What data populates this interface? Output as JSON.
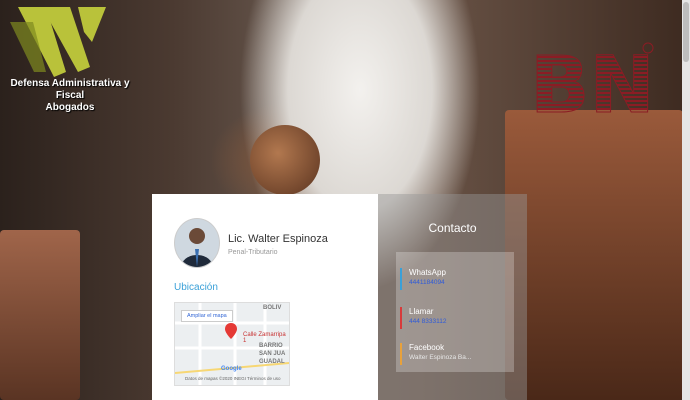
{
  "header": {
    "logo_left_text": "Defensa Administrativa y Fiscal Abogados",
    "logo_left_line1": "Defensa Administrativa y Fiscal",
    "logo_left_line2": "Abogados",
    "logo_right_text": "BNI"
  },
  "profile": {
    "name": "Lic. Walter Espinoza",
    "role": "Penal-Tributario",
    "location_title": "Ubicación"
  },
  "map": {
    "expand_label": "Ampliar el mapa",
    "street_label": "Calle Zamarripa 1",
    "labels": [
      "BOLIV",
      "BARRIO",
      "SAN JUA",
      "GUADAL"
    ],
    "google": "Google",
    "footer": "Datos de mapas ©2020 INEGI    Términos de uso"
  },
  "contact": {
    "title": "Contacto",
    "items": [
      {
        "title": "WhatsApp",
        "value": "4441184094",
        "color": "#3aa0d8"
      },
      {
        "title": "Llamar",
        "value": "444 8333112",
        "color": "#d83a3a"
      },
      {
        "title": "Facebook",
        "value": "Walter Espinoza Ba...",
        "color": "#e8a13a"
      }
    ]
  },
  "colors": {
    "accent": "#3aa0d8",
    "logo_green": "#b9c23a",
    "bni_red": "#8b1c24"
  }
}
